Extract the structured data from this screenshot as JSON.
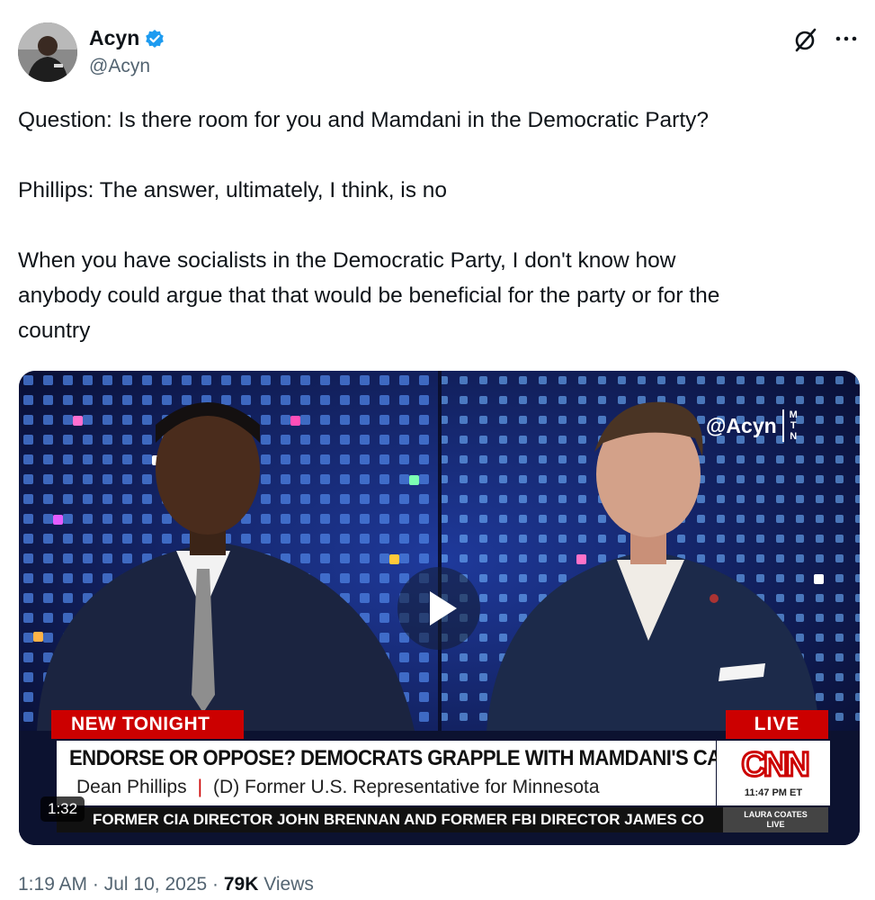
{
  "author": {
    "name": "Acyn",
    "handle": "@Acyn",
    "verified": true,
    "verified_color": "#1d9bf0"
  },
  "header_icons": [
    "grok-icon",
    "more-options-icon"
  ],
  "tweet": {
    "text": "Question: Is there room for you and Mamdani in the Democratic Party?\n\nPhillips: The answer, ultimately, I think, is no\n\nWhen you have socialists in the Democratic Party, I don't know how\nanybody could argue that that would be beneficial for the party or for the\ncountry"
  },
  "video": {
    "duration": "1:32",
    "watermark": "@Acyn",
    "watermark_tag": [
      "M",
      "T",
      "N"
    ],
    "banner_left": "NEW TONIGHT",
    "banner_right": "LIVE",
    "headline": "ENDORSE OR OPPOSE? DEMOCRATS GRAPPLE WITH MAMDANI'S CANDIDACY",
    "guest_name": "Dean Phillips",
    "guest_separator": "|",
    "guest_title": "(D) Former U.S. Representative for Minnesota",
    "network": "CNN",
    "time": "11:47 PM ET",
    "ticker": "FORMER CIA DIRECTOR JOHN BRENNAN AND FORMER FBI DIRECTOR JAMES CO",
    "show_badge": [
      "LAURA COATES",
      "LIVE"
    ],
    "accent_red": "#cc0000"
  },
  "meta": {
    "time": "1:19 AM",
    "dot": "·",
    "date": "Jul 10, 2025",
    "views_count": "79K",
    "views_label": "Views"
  }
}
